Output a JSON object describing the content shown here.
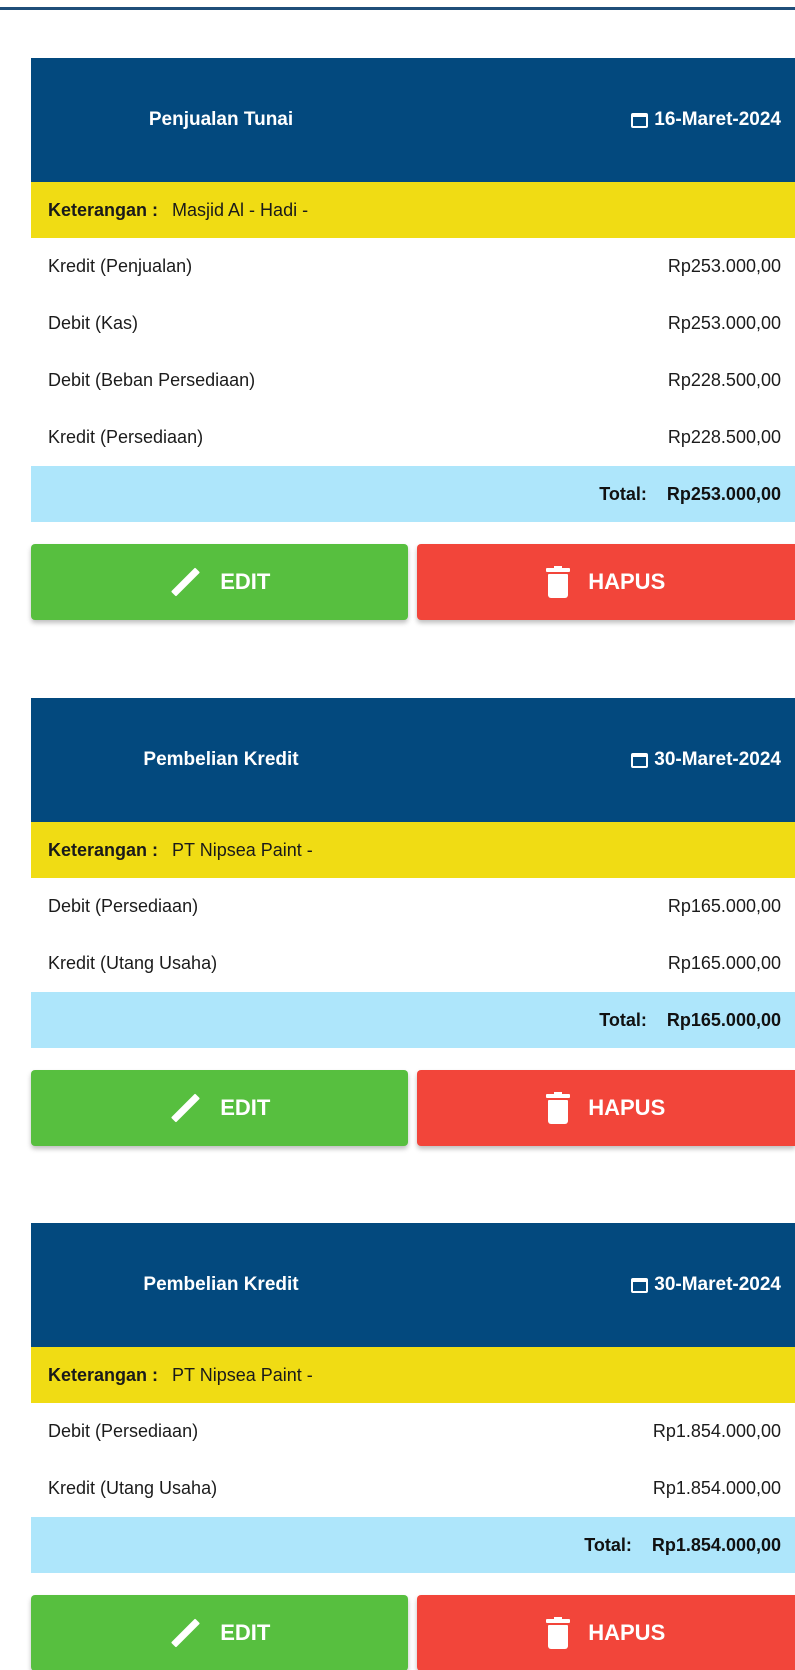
{
  "colors": {
    "header_bg": "#03497e",
    "keterangan_bg": "#f0dc14",
    "total_bg": "#aee6fb",
    "edit_bg": "#57bf3f",
    "hapus_bg": "#f2453a"
  },
  "keterangan_label": "Keterangan :",
  "total_label": "Total:",
  "edit_label": "EDIT",
  "hapus_label": "HAPUS",
  "transactions": [
    {
      "type": "Penjualan Tunai",
      "date": "16-Maret-2024",
      "keterangan": "Masjid Al - Hadi -",
      "rows": [
        {
          "label": "Kredit (Penjualan)",
          "amount": "Rp253.000,00"
        },
        {
          "label": "Debit (Kas)",
          "amount": "Rp253.000,00"
        },
        {
          "label": "Debit (Beban Persediaan)",
          "amount": "Rp228.500,00"
        },
        {
          "label": "Kredit (Persediaan)",
          "amount": "Rp228.500,00"
        }
      ],
      "total": "Rp253.000,00"
    },
    {
      "type": "Pembelian Kredit",
      "date": "30-Maret-2024",
      "keterangan": "PT Nipsea Paint -",
      "rows": [
        {
          "label": "Debit (Persediaan)",
          "amount": "Rp165.000,00"
        },
        {
          "label": "Kredit (Utang Usaha)",
          "amount": "Rp165.000,00"
        }
      ],
      "total": "Rp165.000,00"
    },
    {
      "type": "Pembelian Kredit",
      "date": "30-Maret-2024",
      "keterangan": "PT Nipsea Paint -",
      "rows": [
        {
          "label": "Debit (Persediaan)",
          "amount": "Rp1.854.000,00"
        },
        {
          "label": "Kredit (Utang Usaha)",
          "amount": "Rp1.854.000,00"
        }
      ],
      "total": "Rp1.854.000,00"
    }
  ]
}
